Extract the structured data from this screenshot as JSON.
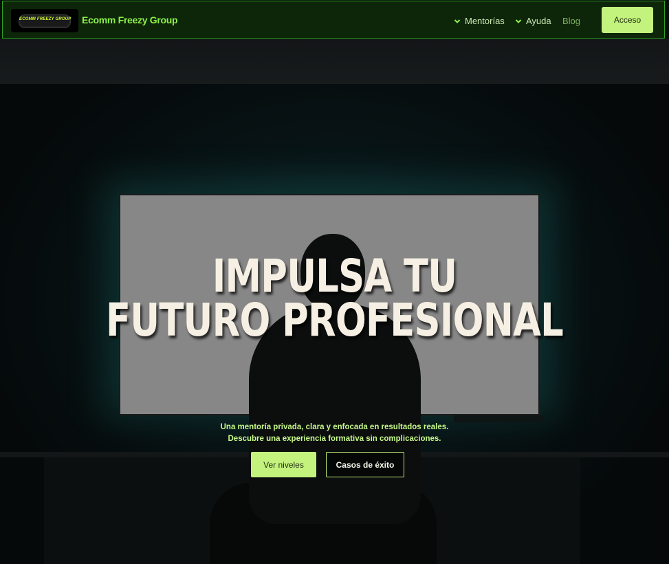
{
  "brand": {
    "logo_text": "ECOMM FREEZY GROUP",
    "name": "Ecomm Freezy Group"
  },
  "nav": {
    "items": [
      {
        "label": "Mentorías",
        "icon": "chevron-down-icon"
      },
      {
        "label": "Ayuda",
        "icon": "chevron-down-icon"
      },
      {
        "label": "Blog"
      }
    ],
    "cta_label": "Acceso"
  },
  "hero": {
    "headline_line1": "IMPULSA TU",
    "headline_line2": "FUTURO PROFESIONAL",
    "subtext_line1": "Una mentoría privada, clara y enfocada en resultados reales.",
    "subtext_line2": "Descubre una experiencia formativa sin complicaciones.",
    "primary_button": "Ver niveles",
    "secondary_button": "Casos de éxito"
  },
  "colors": {
    "accent": "#c3f27d",
    "brand_green": "#8ff04a",
    "nav_border": "#2aa31c",
    "headline": "#f6efe3"
  }
}
